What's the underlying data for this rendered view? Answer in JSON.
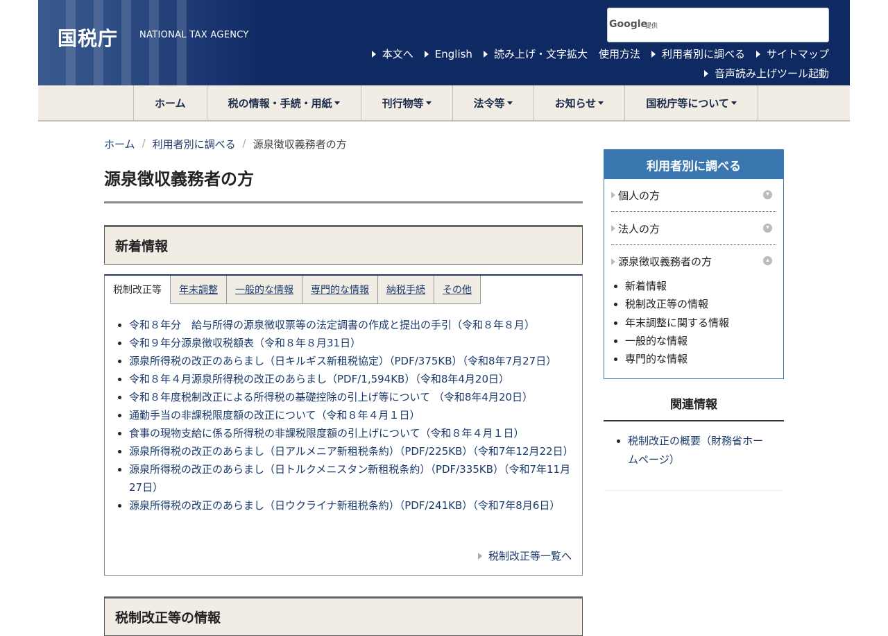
{
  "header": {
    "logo": "国税庁",
    "agency_en": "NATIONAL TAX AGENCY",
    "search_brand": "Google",
    "search_sub": "提供",
    "util_links": [
      "本文へ",
      "English",
      "読み上げ・文字拡大",
      "使用方法",
      "利用者別に調べる",
      "サイトマップ"
    ],
    "util_link2": "音声読み上げツール起動"
  },
  "nav": {
    "items": [
      "ホーム",
      "税の情報・手続・用紙",
      "刊行物等",
      "法令等",
      "お知らせ",
      "国税庁等について"
    ]
  },
  "breadcrumb": [
    "ホーム",
    "利用者別に調べる",
    "源泉徴収義務者の方"
  ],
  "page_title": "源泉徴収義務者の方",
  "news": {
    "heading": "新着情報",
    "tabs": [
      "税制改正等",
      "年末調整",
      "一般的な情報",
      "専門的な情報",
      "納税手続",
      "その他"
    ],
    "items": [
      "令和８年分　給与所得の源泉徴収票等の法定調書の作成と提出の手引（令和８年８月）",
      "令和９年分源泉徴収税額表（令和８年８月31日）",
      "源泉所得税の改正のあらまし（日キルギス新租税協定）（PDF/375KB）（令和8年7月27日）",
      "令和８年４月源泉所得税の改正のあらまし（PDF/1,594KB）（令和8年4月20日）",
      "令和８年度税制改正による所得税の基礎控除の引上げ等について （令和8年4月20日）",
      "通勤手当の非課税限度額の改正について（令和８年４月１日）",
      "食事の現物支給に係る所得税の非課税限度額の引上げについて（令和８年４月１日）",
      "源泉所得税の改正のあらまし（日アルメニア新租税条約）（PDF/225KB）（令和7年12月22日）",
      "源泉所得税の改正のあらまし（日トルクメニスタン新租税条約）（PDF/335KB）（令和7年11月27日）",
      "源泉所得税の改正のあらまし（日ウクライナ新租税条約）（PDF/241KB）（令和7年8月6日）"
    ],
    "more_link": "税制改正等一覧へ"
  },
  "section2_heading": "税制改正等の情報",
  "sidebar": {
    "heading": "利用者別に調べる",
    "items": [
      "個人の方",
      "法人の方",
      "源泉徴収義務者の方"
    ],
    "sub_items": [
      "新着情報",
      "税制改正等の情報",
      "年末調整に関する情報",
      "一般的な情報",
      "専門的な情報"
    ],
    "related_heading": "関連情報",
    "related_items": [
      "税制改正の概要（財務省ホームページ）"
    ]
  }
}
